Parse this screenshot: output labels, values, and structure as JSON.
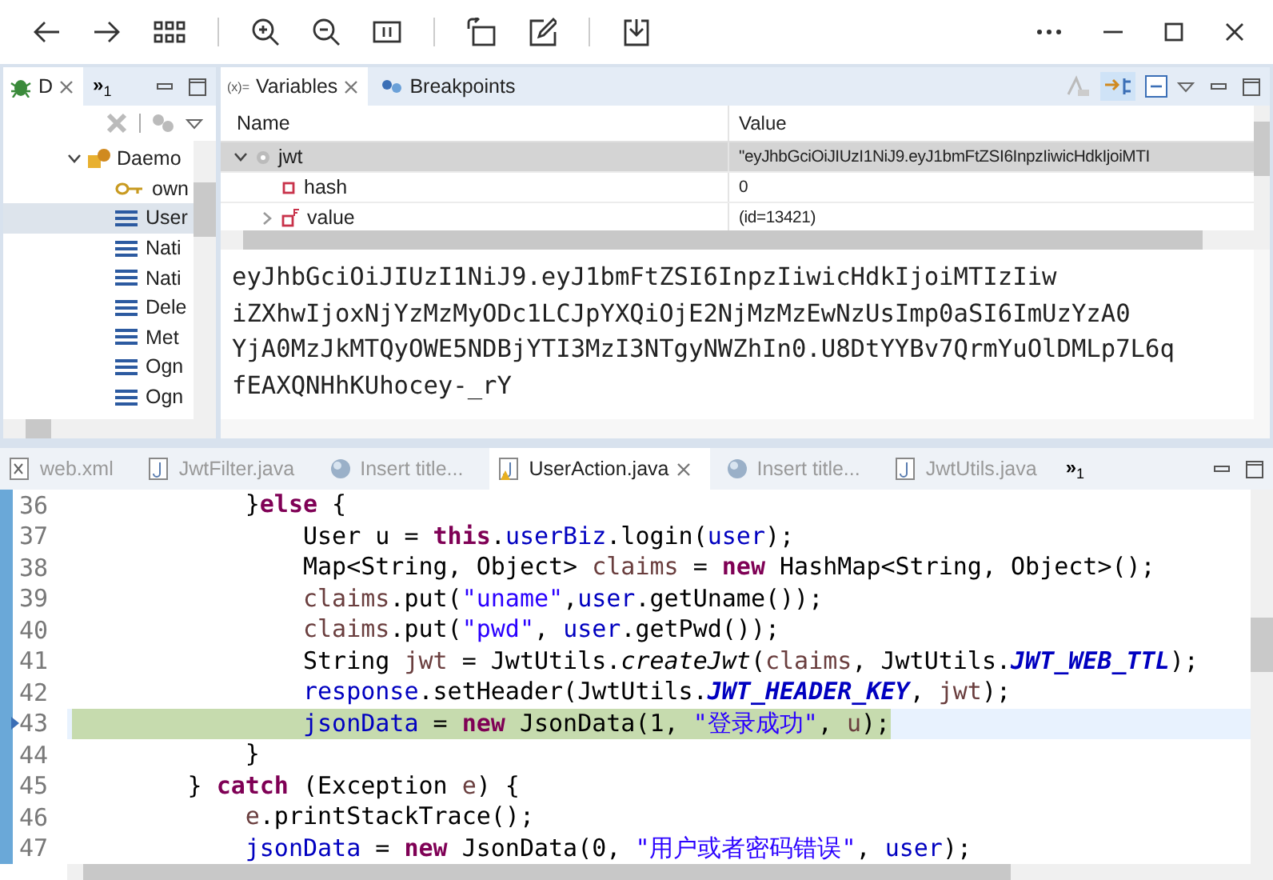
{
  "debug_view": {
    "tab": {
      "label": "D",
      "selected": true
    },
    "overflow": {
      "symbol": "»",
      "count": "1"
    },
    "tree": [
      {
        "label": "Daemo",
        "kind": "thread",
        "expanded": true,
        "selected": false,
        "children": [
          {
            "label": "own",
            "kind": "key",
            "selected": false
          },
          {
            "label": "User",
            "kind": "frame",
            "selected": true
          },
          {
            "label": "Nati",
            "kind": "frame",
            "selected": false
          },
          {
            "label": "Nati",
            "kind": "frame",
            "selected": false
          },
          {
            "label": "Dele",
            "kind": "frame",
            "selected": false
          },
          {
            "label": "Met",
            "kind": "frame",
            "selected": false
          },
          {
            "label": "Ogn",
            "kind": "frame",
            "selected": false
          },
          {
            "label": "Ogn",
            "kind": "frame",
            "selected": false
          }
        ]
      }
    ]
  },
  "variables_view": {
    "tabs": [
      {
        "label": "Variables",
        "prefix": "(x)=",
        "kind": "variables",
        "selected": true
      },
      {
        "label": "Breakpoints",
        "kind": "breakpoints",
        "selected": false
      }
    ],
    "columns": [
      "Name",
      "Value"
    ],
    "rows": [
      {
        "name": "jwt",
        "kind": "local",
        "value": "\"eyJhbGciOiJIUzI1NiJ9.eyJ1bmFtZSI6InpzIiwicHdkIjoiMTI",
        "expanded": true,
        "selected": true,
        "children": [
          {
            "name": "hash",
            "kind": "field",
            "value": "0"
          },
          {
            "name": "value",
            "kind": "final_field",
            "value": "(id=13421)",
            "expanded": false
          }
        ]
      }
    ],
    "detail_lines": [
      "eyJhbGciOiJIUzI1NiJ9.eyJ1bmFtZSI6InpzIiwicHdkIjoiMTIzIiw",
      "iZXhwIjoxNjYzMzMyODc1LCJpYXQiOjE2NjMzMzEwNzUsImp0aSI6ImUzYzA0",
      "YjA0MzJkMTQyOWE5NDBjYTI3MzI3NTgyNWZhIn0.U8DtYYBv7QrmYuOlDMLp7L6q",
      "fEAXQNHhKUhocey-_rY"
    ]
  },
  "editor": {
    "tabs": [
      {
        "label": "web.xml",
        "kind": "xml",
        "selected": false
      },
      {
        "label": "JwtFilter.java",
        "kind": "java",
        "selected": false
      },
      {
        "label": "Insert title...",
        "kind": "web",
        "selected": false
      },
      {
        "label": "UserAction.java",
        "kind": "java_warn",
        "selected": true
      },
      {
        "label": "Insert title...",
        "kind": "web",
        "selected": false
      },
      {
        "label": "JwtUtils.java",
        "kind": "java",
        "selected": false
      }
    ],
    "overflow": {
      "symbol": "»",
      "count": "1"
    },
    "lines": [
      {
        "number": "36",
        "current": false,
        "segments": [
          {
            "kind": "plain",
            "text": "            }"
          },
          {
            "kind": "keyword",
            "text": "else"
          },
          {
            "kind": "plain",
            "text": " {"
          }
        ]
      },
      {
        "number": "37",
        "current": false,
        "segments": [
          {
            "kind": "plain",
            "text": "                User u = "
          },
          {
            "kind": "keyword",
            "text": "this"
          },
          {
            "kind": "plain",
            "text": "."
          },
          {
            "kind": "field",
            "text": "userBiz"
          },
          {
            "kind": "plain",
            "text": ".login("
          },
          {
            "kind": "field",
            "text": "user"
          },
          {
            "kind": "plain",
            "text": ");"
          }
        ]
      },
      {
        "number": "38",
        "current": false,
        "segments": [
          {
            "kind": "plain",
            "text": "                Map<String, Object> "
          },
          {
            "kind": "local",
            "text": "claims"
          },
          {
            "kind": "plain",
            "text": " = "
          },
          {
            "kind": "keyword",
            "text": "new"
          },
          {
            "kind": "plain",
            "text": " HashMap<String, Object>();"
          }
        ]
      },
      {
        "number": "39",
        "current": false,
        "segments": [
          {
            "kind": "local",
            "text": "                claims"
          },
          {
            "kind": "plain",
            "text": ".put("
          },
          {
            "kind": "string",
            "text": "\"uname\""
          },
          {
            "kind": "plain",
            "text": ","
          },
          {
            "kind": "field",
            "text": "user"
          },
          {
            "kind": "plain",
            "text": ".getUname());"
          }
        ]
      },
      {
        "number": "40",
        "current": false,
        "segments": [
          {
            "kind": "local",
            "text": "                claims"
          },
          {
            "kind": "plain",
            "text": ".put("
          },
          {
            "kind": "string",
            "text": "\"pwd\""
          },
          {
            "kind": "plain",
            "text": ", "
          },
          {
            "kind": "field",
            "text": "user"
          },
          {
            "kind": "plain",
            "text": ".getPwd());"
          }
        ]
      },
      {
        "number": "41",
        "current": false,
        "segments": [
          {
            "kind": "plain",
            "text": "                String "
          },
          {
            "kind": "local",
            "text": "jwt"
          },
          {
            "kind": "plain",
            "text": " = JwtUtils."
          },
          {
            "kind": "static_method",
            "text": "createJwt"
          },
          {
            "kind": "plain",
            "text": "("
          },
          {
            "kind": "local",
            "text": "claims"
          },
          {
            "kind": "plain",
            "text": ", JwtUtils."
          },
          {
            "kind": "static_field",
            "text": "JWT_WEB_TTL"
          },
          {
            "kind": "plain",
            "text": ");"
          }
        ]
      },
      {
        "number": "42",
        "current": false,
        "segments": [
          {
            "kind": "field",
            "text": "                response"
          },
          {
            "kind": "plain",
            "text": ".setHeader(JwtUtils."
          },
          {
            "kind": "static_field",
            "text": "JWT_HEADER_KEY"
          },
          {
            "kind": "plain",
            "text": ", "
          },
          {
            "kind": "local",
            "text": "jwt"
          },
          {
            "kind": "plain",
            "text": ");"
          }
        ]
      },
      {
        "number": "43",
        "current": true,
        "segments": [
          {
            "kind": "field",
            "text": "                jsonData"
          },
          {
            "kind": "plain",
            "text": " = "
          },
          {
            "kind": "keyword",
            "text": "new"
          },
          {
            "kind": "plain",
            "text": " JsonData(1, "
          },
          {
            "kind": "string",
            "text": "\"登录成功\""
          },
          {
            "kind": "plain",
            "text": ", "
          },
          {
            "kind": "local",
            "text": "u"
          },
          {
            "kind": "plain",
            "text": ");"
          }
        ]
      },
      {
        "number": "44",
        "current": false,
        "segments": [
          {
            "kind": "plain",
            "text": "            }"
          }
        ]
      },
      {
        "number": "45",
        "current": false,
        "segments": [
          {
            "kind": "plain",
            "text": "        } "
          },
          {
            "kind": "keyword",
            "text": "catch"
          },
          {
            "kind": "plain",
            "text": " (Exception "
          },
          {
            "kind": "local",
            "text": "e"
          },
          {
            "kind": "plain",
            "text": ") {"
          }
        ]
      },
      {
        "number": "46",
        "current": false,
        "segments": [
          {
            "kind": "local",
            "text": "            e"
          },
          {
            "kind": "plain",
            "text": ".printStackTrace();"
          }
        ]
      },
      {
        "number": "47",
        "current": false,
        "segments": [
          {
            "kind": "field",
            "text": "            jsonData"
          },
          {
            "kind": "plain",
            "text": " = "
          },
          {
            "kind": "keyword",
            "text": "new"
          },
          {
            "kind": "plain",
            "text": " JsonData(0, "
          },
          {
            "kind": "string",
            "text": "\"用户或者密码错误\""
          },
          {
            "kind": "plain",
            "text": ", "
          },
          {
            "kind": "field",
            "text": "user"
          },
          {
            "kind": "plain",
            "text": ");"
          }
        ]
      }
    ]
  }
}
